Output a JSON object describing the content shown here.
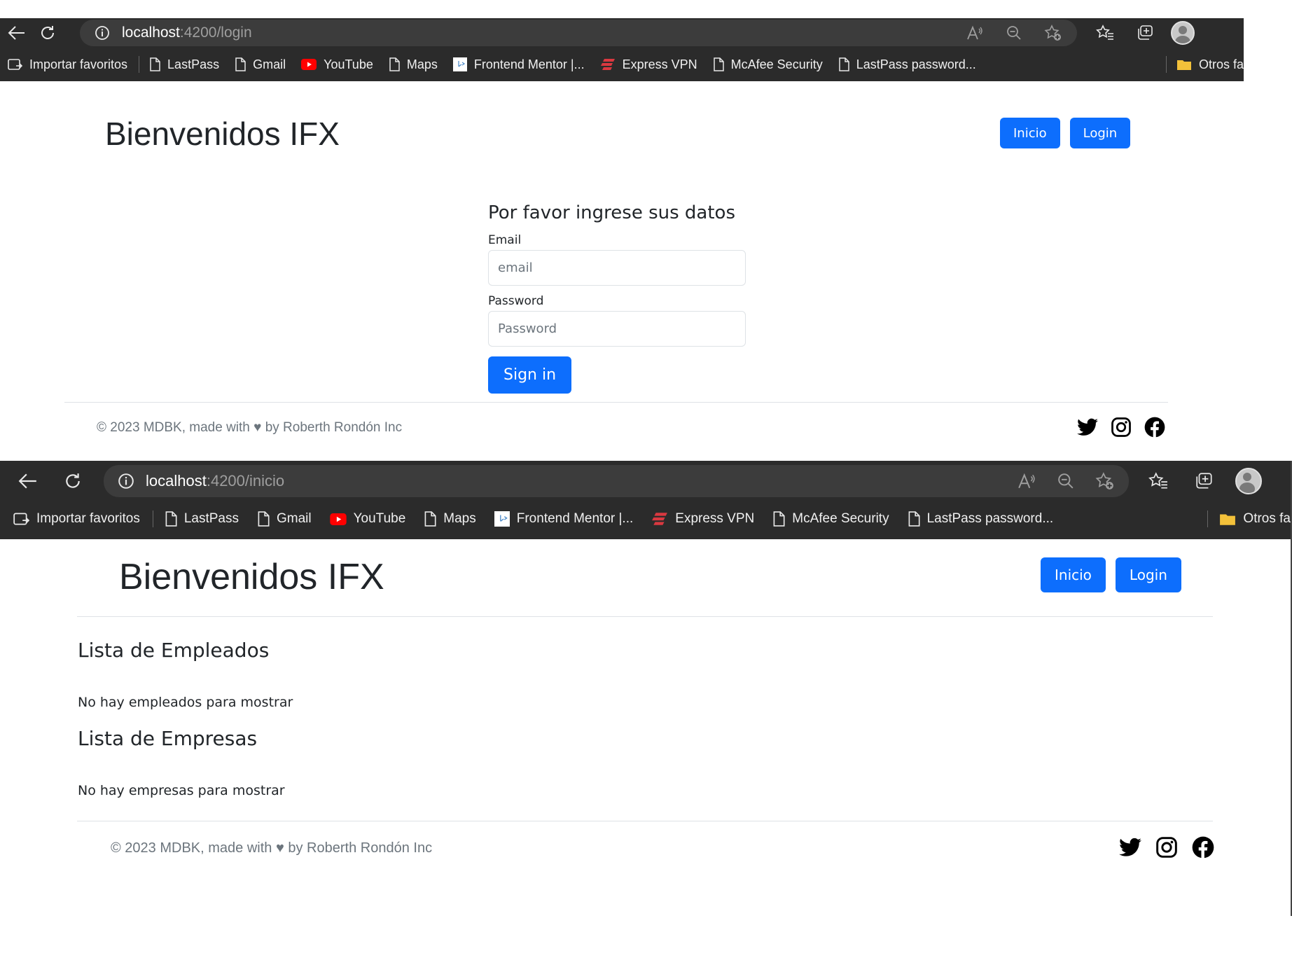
{
  "browser_login": {
    "url_host": "localhost",
    "url_path": ":4200/login"
  },
  "browser_inicio": {
    "url_host": "localhost",
    "url_path": ":4200/inicio"
  },
  "bookmarks": [
    {
      "label": "Importar favoritos",
      "icon": "import-icon"
    },
    {
      "label": "LastPass",
      "icon": "page-icon"
    },
    {
      "label": "Gmail",
      "icon": "page-icon"
    },
    {
      "label": "YouTube",
      "icon": "youtube-icon"
    },
    {
      "label": "Maps",
      "icon": "page-icon"
    },
    {
      "label": "Frontend Mentor |...",
      "icon": "frontend-mentor-icon"
    },
    {
      "label": "Express VPN",
      "icon": "expressvpn-icon"
    },
    {
      "label": "McAfee Security",
      "icon": "page-icon"
    },
    {
      "label": "LastPass password...",
      "icon": "page-icon"
    }
  ],
  "bookmarks_other_login": "Otros fa",
  "bookmarks_other_inicio": "Otros fa",
  "header": {
    "brand": "Bienvenidos IFX",
    "nav_inicio": "Inicio",
    "nav_login": "Login"
  },
  "login": {
    "title": "Por favor ingrese sus datos",
    "email_label": "Email",
    "email_placeholder": "email",
    "password_label": "Password",
    "password_placeholder": "Password",
    "submit": "Sign in"
  },
  "inicio": {
    "employees_title": "Lista de Empleados",
    "employees_empty": "No hay empleados para mostrar",
    "companies_title": "Lista de Empresas",
    "companies_empty": "No hay empresas para mostrar"
  },
  "footer": {
    "text": "© 2023 MDBK, made with ♥ by Roberth Rondón Inc",
    "social": [
      "twitter-icon",
      "instagram-icon",
      "facebook-icon"
    ]
  },
  "colors": {
    "primary": "#0d6efd",
    "chrome": "#2b2b2b"
  }
}
